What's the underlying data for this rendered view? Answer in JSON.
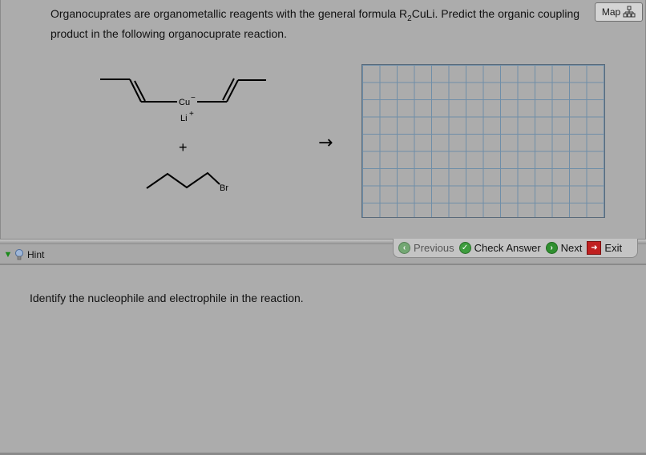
{
  "question": {
    "text_before": "Organocuprates are organometallic reagents with the general formula R",
    "text_sub": "2",
    "text_after": "CuLi. Predict the organic coupling product in the following organocuprate reaction."
  },
  "map_button": {
    "label": "Map"
  },
  "reaction": {
    "cu_label": "Cu",
    "cu_charge": "−",
    "li_label": "Li",
    "li_charge": "+",
    "plus": "+",
    "br_label": "Br",
    "arrow": "→"
  },
  "hint_bar": {
    "label": "Hint"
  },
  "nav": {
    "previous": "Previous",
    "check_answer": "Check Answer",
    "next": "Next",
    "exit": "Exit"
  },
  "hint_panel": {
    "text": "Identify the nucleophile and electrophile in the reaction."
  },
  "colors": {
    "background": "#acacac",
    "grid_line": "#6f8ea8",
    "check_green": "#3e9d3e",
    "exit_red": "#c02020"
  },
  "icons": [
    "map-icon",
    "hint-toggle-icon",
    "lightbulb-icon",
    "previous-icon",
    "check-icon",
    "next-icon",
    "exit-icon"
  ]
}
